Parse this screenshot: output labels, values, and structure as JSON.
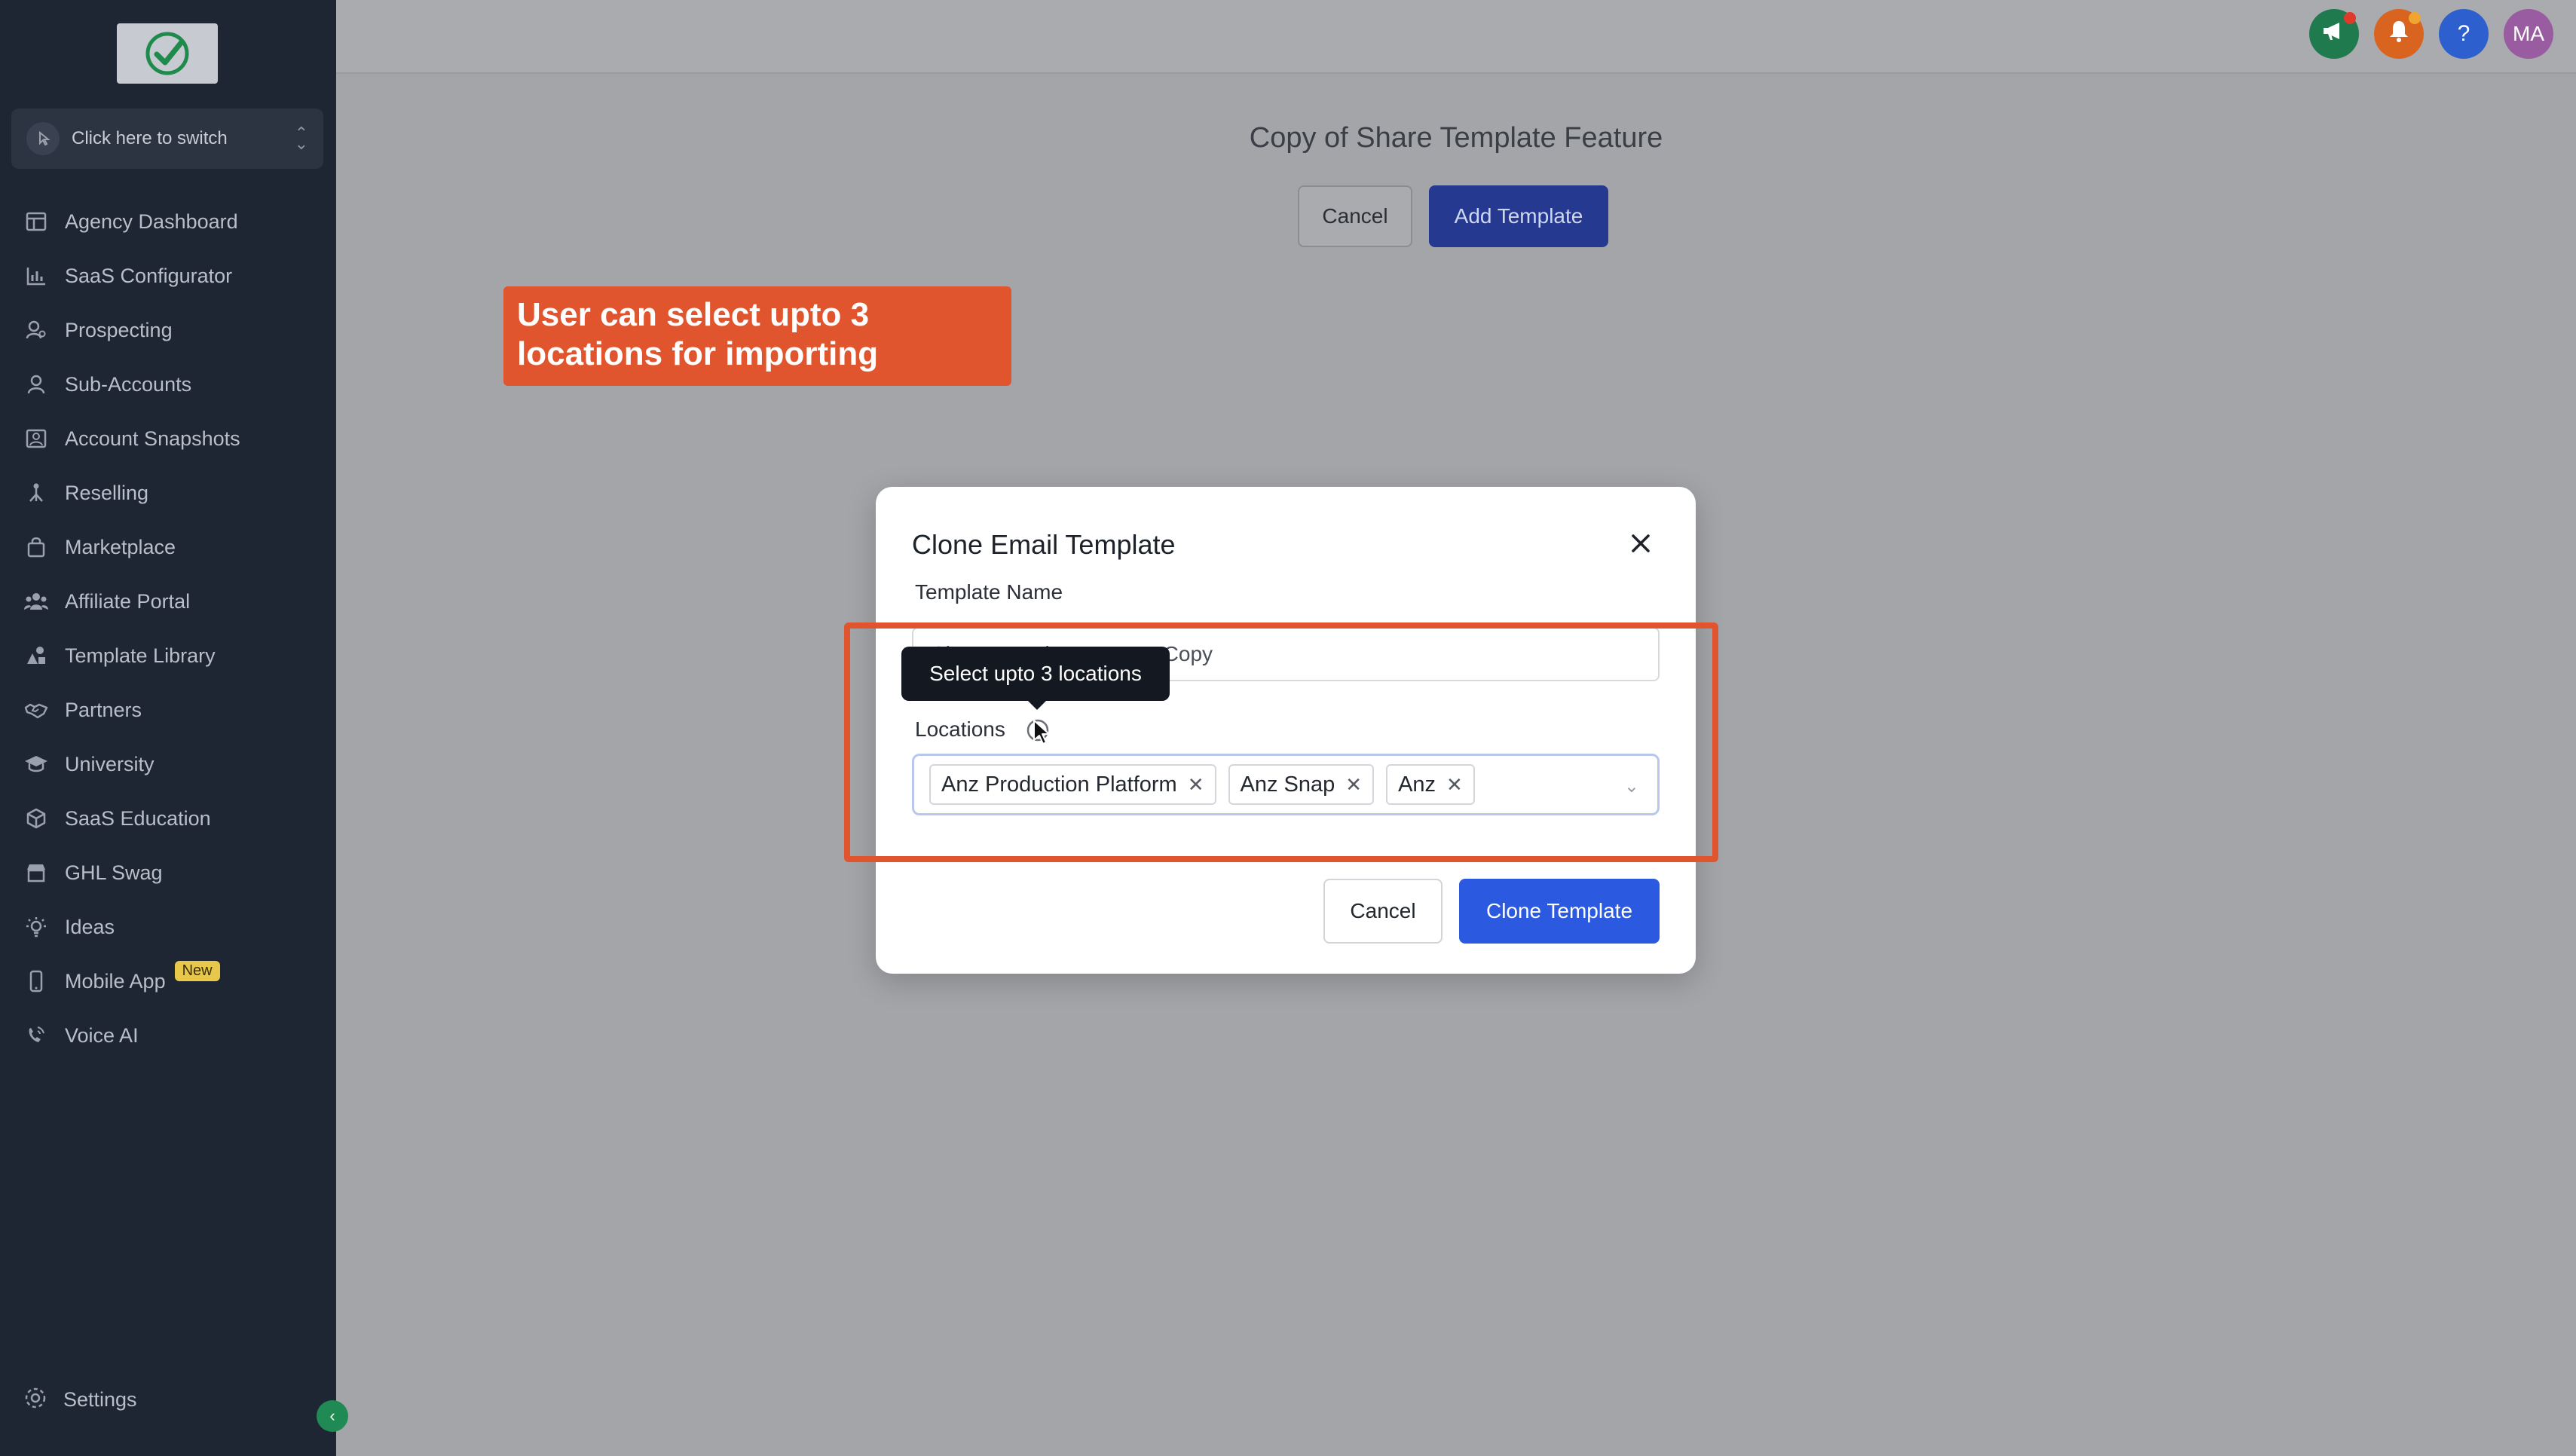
{
  "sidebar": {
    "switcher_label": "Click here to switch",
    "items": [
      {
        "label": "Agency Dashboard",
        "icon": "dashboard-icon"
      },
      {
        "label": "SaaS Configurator",
        "icon": "bar-chart-icon"
      },
      {
        "label": "Prospecting",
        "icon": "user-search-icon"
      },
      {
        "label": "Sub-Accounts",
        "icon": "user-icon"
      },
      {
        "label": "Account Snapshots",
        "icon": "snapshot-icon"
      },
      {
        "label": "Reselling",
        "icon": "network-icon"
      },
      {
        "label": "Marketplace",
        "icon": "shopping-bag-icon"
      },
      {
        "label": "Affiliate Portal",
        "icon": "users-icon"
      },
      {
        "label": "Template Library",
        "icon": "shapes-icon"
      },
      {
        "label": "Partners",
        "icon": "handshake-icon"
      },
      {
        "label": "University",
        "icon": "graduation-cap-icon"
      },
      {
        "label": "SaaS Education",
        "icon": "cubes-icon"
      },
      {
        "label": "GHL Swag",
        "icon": "store-icon"
      },
      {
        "label": "Ideas",
        "icon": "lightbulb-icon"
      },
      {
        "label": "Mobile App",
        "icon": "mobile-icon",
        "badge": "New"
      },
      {
        "label": "Voice AI",
        "icon": "phone-wave-icon"
      }
    ],
    "settings_label": "Settings"
  },
  "topbar": {
    "avatar_initials": "MA",
    "help_glyph": "?"
  },
  "page": {
    "title": "Copy of Share Template Feature",
    "cancel_label": "Cancel",
    "add_template_label": "Add Template"
  },
  "callout": {
    "text": "User can select upto 3 locations for importing"
  },
  "modal": {
    "title": "Clone Email Template",
    "template_name_label": "Template Name",
    "template_name_value": "Share Template Feature Copy",
    "tooltip": "Select upto 3 locations",
    "locations_label": "Locations",
    "selected_locations": [
      "Anz Production Platform",
      "Anz Snap",
      "Anz"
    ],
    "cancel_label": "Cancel",
    "clone_label": "Clone Template"
  },
  "colors": {
    "sidebar_bg": "#1f2633",
    "accent": "#2b59df",
    "callout": "#e0552d",
    "announce": "#1f7a4d",
    "bell": "#d9641f",
    "help": "#2e5fcf",
    "avatar": "#9a5ca0"
  }
}
